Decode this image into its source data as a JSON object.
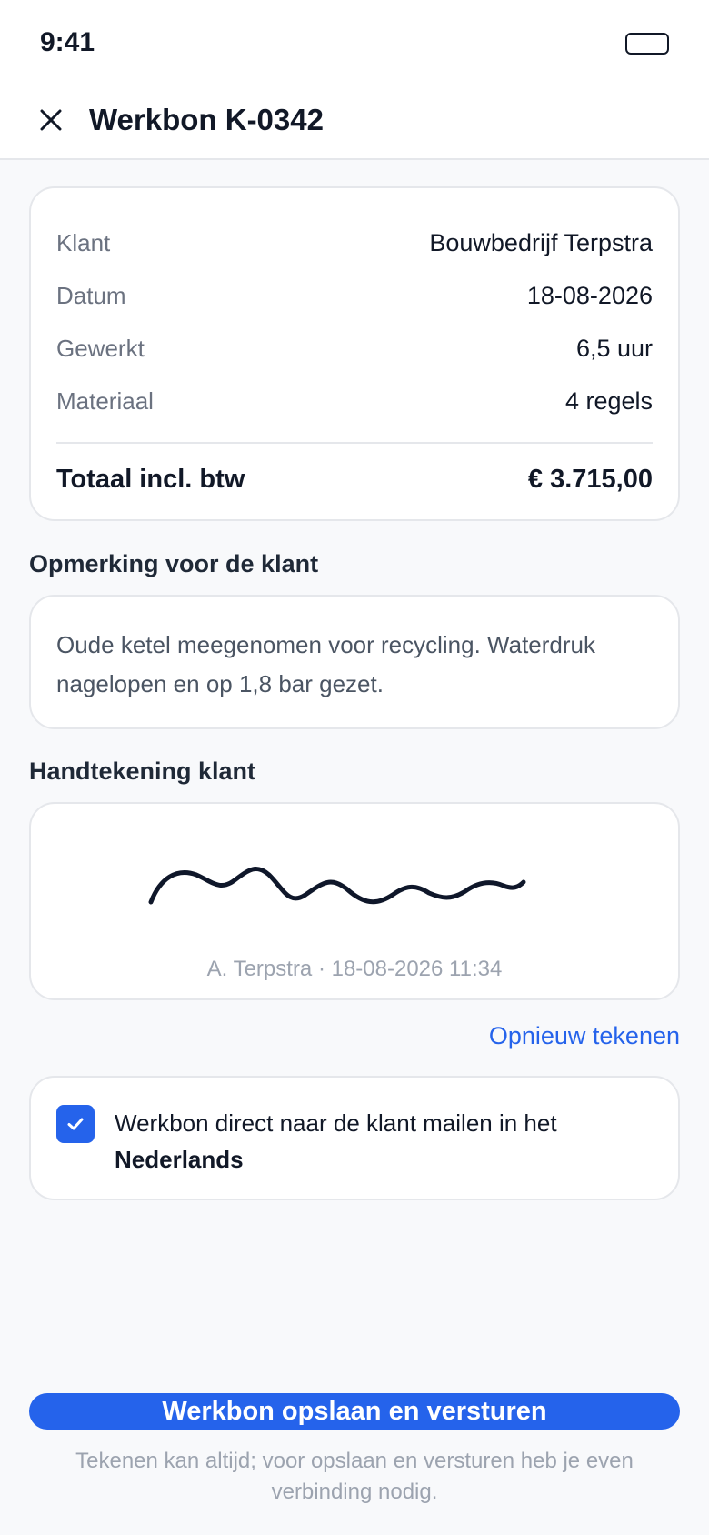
{
  "status_bar": {
    "time": "9:41"
  },
  "header": {
    "title": "Werkbon K-0342"
  },
  "summary": {
    "rows": [
      {
        "label": "Klant",
        "value": "Bouwbedrijf Terpstra"
      },
      {
        "label": "Datum",
        "value": "18-08-2026"
      },
      {
        "label": "Gewerkt",
        "value": "6,5 uur"
      },
      {
        "label": "Materiaal",
        "value": "4 regels"
      }
    ],
    "total_label": "Totaal incl. btw",
    "total_value": "€ 3.715,00"
  },
  "note": {
    "title": "Opmerking voor de klant",
    "text": "Oude ketel meegenomen voor recycling. Waterdruk nagelopen en op 1,8 bar gezet."
  },
  "signature": {
    "title": "Handtekening klant",
    "meta": "A. Terpstra · 18-08-2026 11:34",
    "redraw_label": "Opnieuw tekenen"
  },
  "email_option": {
    "checked": true,
    "text": "Werkbon direct naar de klant mailen in het",
    "language": "Nederlands"
  },
  "submit": {
    "label": "Werkbon opslaan en versturen"
  },
  "footer_hint": "Tekenen kan altijd; voor opslaan en versturen heb je even verbinding nodig.",
  "colors": {
    "accent": "#2563eb",
    "text": "#111827",
    "muted": "#6b7280",
    "border": "#e5e7eb",
    "background": "#f8f9fb"
  },
  "icons": {
    "close": "close-icon",
    "battery": "battery-icon",
    "check": "check-icon"
  }
}
